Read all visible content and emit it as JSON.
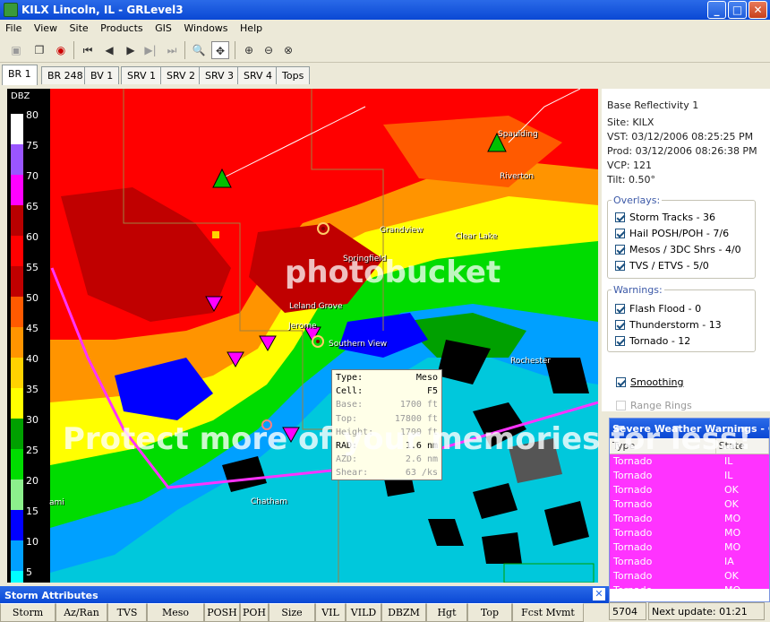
{
  "window": {
    "title": "KILX Lincoln, IL - GRLevel3",
    "minimize": "_",
    "maximize": "□",
    "close": "✕"
  },
  "menu": [
    "File",
    "View",
    "Site",
    "Products",
    "GIS",
    "Windows",
    "Help"
  ],
  "tabs": [
    "BR 1",
    "BR 248",
    "BV 1",
    "SRV 1",
    "SRV 2",
    "SRV 3",
    "SRV 4",
    "Tops"
  ],
  "active_tab": "BR 1",
  "legend": {
    "unit": "DBZ",
    "labels": [
      "80",
      "75",
      "70",
      "65",
      "60",
      "55",
      "50",
      "45",
      "40",
      "35",
      "30",
      "25",
      "20",
      "15",
      "10",
      "5"
    ],
    "colors": [
      "#ffffff",
      "#9a55ff",
      "#ff00ff",
      "#b80000",
      "#ff0000",
      "#c00000",
      "#ff5a00",
      "#ff9400",
      "#ffd200",
      "#ffff00",
      "#00a000",
      "#00dc00",
      "#8cf08c",
      "#0000ff",
      "#00a0ff",
      "#00ffff"
    ]
  },
  "map_labels": [
    "Spaulding",
    "Riverton",
    "Grandview",
    "Clear Lake",
    "Springfield",
    "Leland Grove",
    "Jerome",
    "Southern View",
    "Rochester",
    "Chatham",
    "ami"
  ],
  "popup": {
    "rows": [
      {
        "k": "Type:",
        "v": "Meso"
      },
      {
        "k": "Cell:",
        "v": "F5"
      },
      {
        "k": "Base:",
        "v": "1700 ft"
      },
      {
        "k": "Top:",
        "v": "17800 ft"
      },
      {
        "k": "Height:",
        "v": "1700 ft"
      },
      {
        "k": "RAD:",
        "v": "1.6 nm"
      },
      {
        "k": "AZD:",
        "v": "2.6 nm"
      },
      {
        "k": "Shear:",
        "v": "63 /ks"
      }
    ]
  },
  "info": {
    "product": "Base Reflectivity 1",
    "site": "Site:  KILX",
    "vst": "VST:  03/12/2006  08:25:25 PM",
    "prod": "Prod: 03/12/2006  08:26:38 PM",
    "vcp": "VCP:  121",
    "tilt": "Tilt:  0.50°"
  },
  "overlays": {
    "title": "Overlays:",
    "items": [
      "Storm Tracks - 36",
      "Hail POSH/POH - 7/6",
      "Mesos / 3DC Shrs - 4/0",
      "TVS  / ETVS - 5/0"
    ]
  },
  "warnings": {
    "title": "Warnings:",
    "items": [
      "Flash Flood - 0",
      "Thunderstorm - 13",
      "Tornado - 12"
    ]
  },
  "smoothing": "Smoothing",
  "range_rings": "Range Rings",
  "severe_panel": {
    "title": "Severe Weather Warnings - GR",
    "col_type": "Type",
    "col_state": "State",
    "rows": [
      {
        "type": "Tornado",
        "state": "IL"
      },
      {
        "type": "Tornado",
        "state": "IL"
      },
      {
        "type": "Tornado",
        "state": "OK"
      },
      {
        "type": "Tornado",
        "state": "OK"
      },
      {
        "type": "Tornado",
        "state": "MO"
      },
      {
        "type": "Tornado",
        "state": "MO"
      },
      {
        "type": "Tornado",
        "state": "MO"
      },
      {
        "type": "Tornado",
        "state": "IA"
      },
      {
        "type": "Tornado",
        "state": "OK"
      },
      {
        "type": "Tornado",
        "state": "MO"
      }
    ]
  },
  "status": {
    "code": "5704",
    "next": "Next update: 01:21"
  },
  "storm_panel": {
    "title": "Storm Attributes",
    "columns": [
      "Storm",
      "Az/Ran",
      "TVS",
      "Meso",
      "POSH",
      "POH",
      "Size",
      "VIL",
      "VILD",
      "DBZM",
      "Hgt",
      "Top",
      "Fcst Mvmt"
    ]
  },
  "watermark": {
    "line1": "photobucket",
    "line2": "Protect more of your memories for less!"
  }
}
